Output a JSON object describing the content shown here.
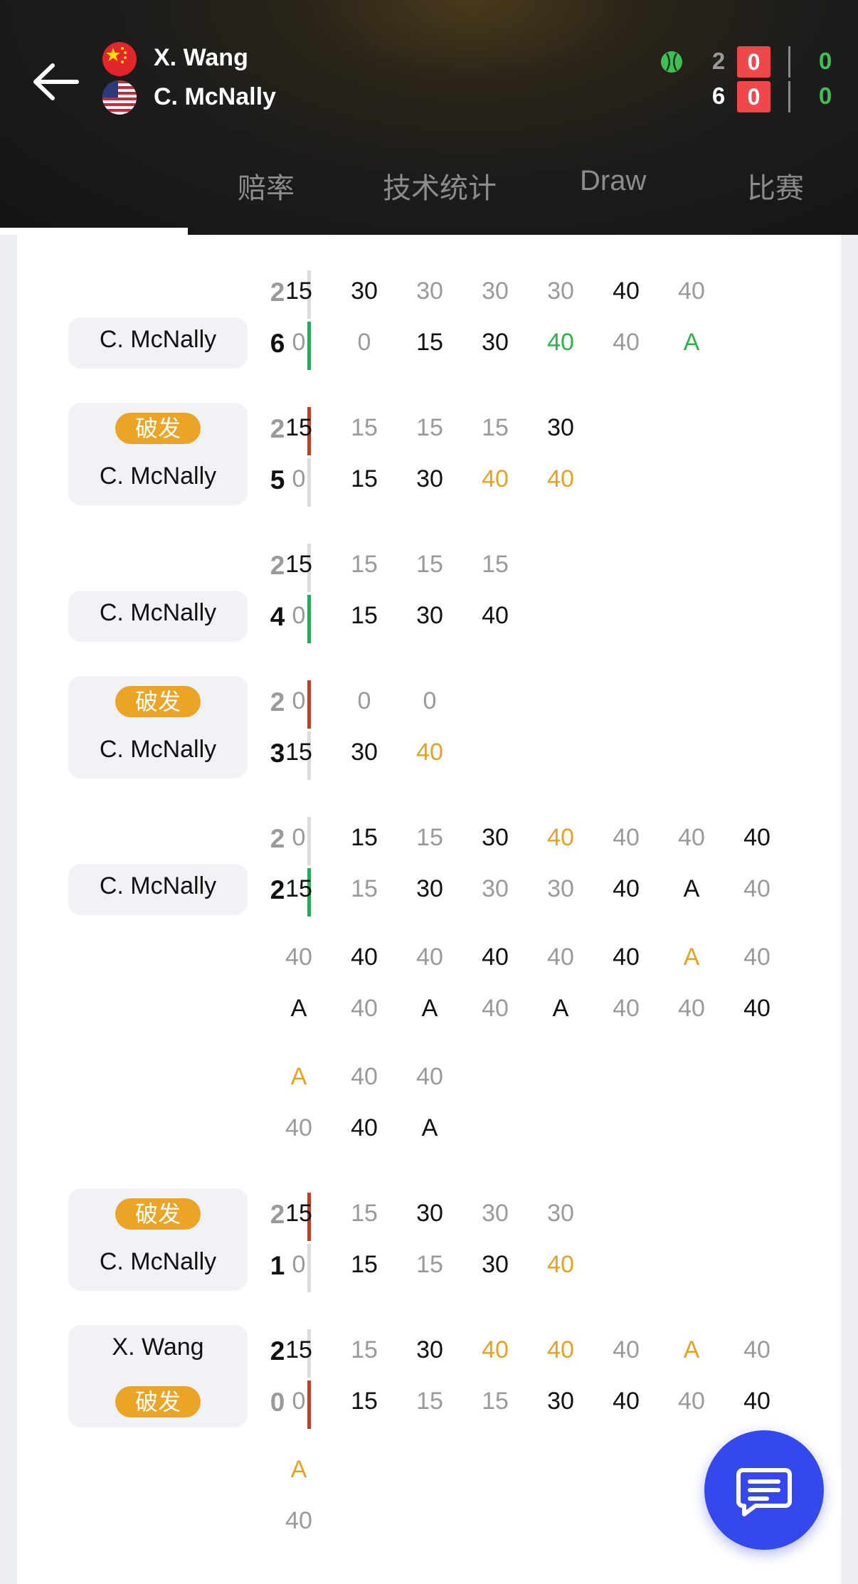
{
  "header": {
    "back_icon": "back-arrow-icon",
    "player1": {
      "name": "X. Wang",
      "flag": "china-flag-icon",
      "sets": "2",
      "games": "0",
      "points": "0"
    },
    "player2": {
      "name": "C. McNally",
      "flag": "usa-flag-icon",
      "sets": "6",
      "games": "0",
      "points": "0"
    },
    "serve_icon": "tennis-ball-icon",
    "colors": {
      "badge": "#f0474a",
      "points": "#3fbf55",
      "background": "#1c1c1c"
    }
  },
  "tabs": [
    {
      "label": "",
      "active": true
    },
    {
      "label": "赔率"
    },
    {
      "label": "技术统计"
    },
    {
      "label": "Draw"
    },
    {
      "label": "比赛"
    }
  ],
  "colors": {
    "point_black": "#111111",
    "point_gray": "#9a9a9a",
    "point_green": "#2db34a",
    "point_orange": "#e6a223",
    "bar_green": "#2ea85a",
    "bar_red": "#b8432c",
    "bar_gray": "#dcdcdc",
    "break_pill": "#eba426",
    "fab": "#3548ee"
  },
  "games": [
    {
      "name_pos": "bottom",
      "name": "C. McNally",
      "break_pos": "",
      "score_top": "2",
      "score_bot": "6",
      "bars": [
        "gray",
        "green"
      ],
      "score_colors": [
        "gray",
        "black"
      ],
      "rows": [
        [
          [
            "15",
            "k"
          ],
          [
            "30",
            "k"
          ],
          [
            "30",
            "g"
          ],
          [
            "30",
            "g"
          ],
          [
            "30",
            "g"
          ],
          [
            "40",
            "k"
          ],
          [
            "40",
            "g"
          ]
        ],
        [
          [
            "0",
            "g"
          ],
          [
            "0",
            "g"
          ],
          [
            "15",
            "k"
          ],
          [
            "30",
            "k"
          ],
          [
            "40",
            "G"
          ],
          [
            "40",
            "g"
          ],
          [
            "A",
            "G"
          ]
        ]
      ]
    },
    {
      "name_pos": "bottom",
      "name": "C. McNally",
      "break_pos": "top",
      "break_label": "破发",
      "score_top": "2",
      "score_bot": "5",
      "bars": [
        "red",
        "gray"
      ],
      "score_colors": [
        "gray",
        "black"
      ],
      "rows": [
        [
          [
            "15",
            "k"
          ],
          [
            "15",
            "g"
          ],
          [
            "15",
            "g"
          ],
          [
            "15",
            "g"
          ],
          [
            "30",
            "k"
          ]
        ],
        [
          [
            "0",
            "g"
          ],
          [
            "15",
            "k"
          ],
          [
            "30",
            "k"
          ],
          [
            "40",
            "o"
          ],
          [
            "40",
            "o"
          ]
        ]
      ]
    },
    {
      "name_pos": "bottom",
      "name": "C. McNally",
      "break_pos": "",
      "score_top": "2",
      "score_bot": "4",
      "bars": [
        "gray",
        "green"
      ],
      "score_colors": [
        "gray",
        "black"
      ],
      "rows": [
        [
          [
            "15",
            "k"
          ],
          [
            "15",
            "g"
          ],
          [
            "15",
            "g"
          ],
          [
            "15",
            "g"
          ]
        ],
        [
          [
            "0",
            "g"
          ],
          [
            "15",
            "k"
          ],
          [
            "30",
            "k"
          ],
          [
            "40",
            "k"
          ]
        ]
      ]
    },
    {
      "name_pos": "bottom",
      "name": "C. McNally",
      "break_pos": "top",
      "break_label": "破发",
      "score_top": "2",
      "score_bot": "3",
      "bars": [
        "red",
        "gray"
      ],
      "score_colors": [
        "gray",
        "black"
      ],
      "rows": [
        [
          [
            "0",
            "g"
          ],
          [
            "0",
            "g"
          ],
          [
            "0",
            "g"
          ]
        ],
        [
          [
            "15",
            "k"
          ],
          [
            "30",
            "k"
          ],
          [
            "40",
            "o"
          ]
        ]
      ]
    },
    {
      "name_pos": "bottom",
      "name": "C. McNally",
      "break_pos": "",
      "score_top": "2",
      "score_bot": "2",
      "bars": [
        "gray",
        "green"
      ],
      "score_colors": [
        "gray",
        "black"
      ],
      "rows": [
        [
          [
            "0",
            "g"
          ],
          [
            "15",
            "k"
          ],
          [
            "15",
            "g"
          ],
          [
            "30",
            "k"
          ],
          [
            "40",
            "o"
          ],
          [
            "40",
            "g"
          ],
          [
            "40",
            "g"
          ],
          [
            "40",
            "k"
          ]
        ],
        [
          [
            "15",
            "k"
          ],
          [
            "15",
            "g"
          ],
          [
            "30",
            "k"
          ],
          [
            "30",
            "g"
          ],
          [
            "30",
            "g"
          ],
          [
            "40",
            "k"
          ],
          [
            "A",
            "k"
          ],
          [
            "40",
            "g"
          ]
        ],
        [
          [
            "40",
            "g"
          ],
          [
            "40",
            "k"
          ],
          [
            "40",
            "g"
          ],
          [
            "40",
            "k"
          ],
          [
            "40",
            "g"
          ],
          [
            "40",
            "k"
          ],
          [
            "A",
            "o"
          ],
          [
            "40",
            "g"
          ]
        ],
        [
          [
            "A",
            "k"
          ],
          [
            "40",
            "g"
          ],
          [
            "A",
            "k"
          ],
          [
            "40",
            "g"
          ],
          [
            "A",
            "k"
          ],
          [
            "40",
            "g"
          ],
          [
            "40",
            "g"
          ],
          [
            "40",
            "k"
          ]
        ],
        [
          [
            "A",
            "o"
          ],
          [
            "40",
            "g"
          ],
          [
            "40",
            "g"
          ]
        ],
        [
          [
            "40",
            "g"
          ],
          [
            "40",
            "k"
          ],
          [
            "A",
            "k"
          ]
        ]
      ]
    },
    {
      "name_pos": "bottom",
      "name": "C. McNally",
      "break_pos": "top",
      "break_label": "破发",
      "score_top": "2",
      "score_bot": "1",
      "bars": [
        "red",
        "gray"
      ],
      "score_colors": [
        "gray",
        "black"
      ],
      "rows": [
        [
          [
            "15",
            "k"
          ],
          [
            "15",
            "g"
          ],
          [
            "30",
            "k"
          ],
          [
            "30",
            "g"
          ],
          [
            "30",
            "g"
          ]
        ],
        [
          [
            "0",
            "g"
          ],
          [
            "15",
            "k"
          ],
          [
            "15",
            "g"
          ],
          [
            "30",
            "k"
          ],
          [
            "40",
            "o"
          ]
        ]
      ]
    },
    {
      "name_pos": "top",
      "name": "X. Wang",
      "break_pos": "bottom",
      "break_label": "破发",
      "score_top": "2",
      "score_bot": "0",
      "bars": [
        "gray",
        "red"
      ],
      "score_colors": [
        "black",
        "gray"
      ],
      "rows": [
        [
          [
            "15",
            "k"
          ],
          [
            "15",
            "g"
          ],
          [
            "30",
            "k"
          ],
          [
            "40",
            "o"
          ],
          [
            "40",
            "o"
          ],
          [
            "40",
            "g"
          ],
          [
            "A",
            "o"
          ],
          [
            "40",
            "g"
          ]
        ],
        [
          [
            "0",
            "g"
          ],
          [
            "15",
            "k"
          ],
          [
            "15",
            "g"
          ],
          [
            "15",
            "g"
          ],
          [
            "30",
            "k"
          ],
          [
            "40",
            "k"
          ],
          [
            "40",
            "g"
          ],
          [
            "40",
            "k"
          ]
        ],
        [
          [
            "A",
            "o"
          ]
        ],
        [
          [
            "40",
            "g"
          ]
        ]
      ]
    }
  ],
  "fab": {
    "icon": "chat-message-icon"
  }
}
